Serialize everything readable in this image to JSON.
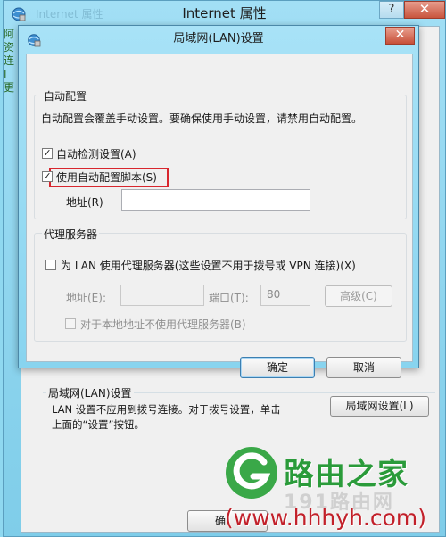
{
  "outer_window": {
    "title": "Internet 属性",
    "ghost_title": "Internet 属性",
    "help_label": "?",
    "close_label": "✕",
    "left_strip": [
      "阿",
      "资",
      "连",
      "I",
      "更"
    ],
    "lan_group": {
      "title": "局域网(LAN)设置",
      "desc_line1": "LAN 设置不应用到拨号连接。对于拨号设置，单击",
      "desc_line2": "上面的“设置”按钮。",
      "settings_button": "局域网设置(L)"
    },
    "ok_button": "确"
  },
  "lan_dialog": {
    "title": "局域网(LAN)设置",
    "close_label": "✕",
    "auto_config": {
      "group_title": "自动配置",
      "description": "自动配置会覆盖手动设置。要确保使用手动设置，请禁用自动配置。",
      "auto_detect": {
        "label": "自动检测设置(A)",
        "checked": true
      },
      "use_script": {
        "label": "使用自动配置脚本(S)",
        "checked": true
      },
      "address_label": "地址(R)",
      "address_value": ""
    },
    "proxy": {
      "group_title": "代理服务器",
      "use_proxy": {
        "label": "为 LAN 使用代理服务器(这些设置不用于拨号或 VPN 连接)(X)",
        "checked": false
      },
      "address_label": "地址(E):",
      "address_value": "",
      "port_label": "端口(T):",
      "port_value": "80",
      "advanced_button": "高级(C)",
      "bypass": {
        "label": "对于本地地址不使用代理服务器(B)",
        "checked": false
      }
    },
    "ok_button": "确定",
    "cancel_button": "取消"
  },
  "watermark": {
    "brand": "路由之家",
    "ghost": "191路由网",
    "url": "(www.hhhyh.com)"
  },
  "colors": {
    "frame": "#8fd8f0",
    "highlight": "#d8262e",
    "brand_green": "#2a9b3a",
    "url_red": "#c2202a"
  }
}
